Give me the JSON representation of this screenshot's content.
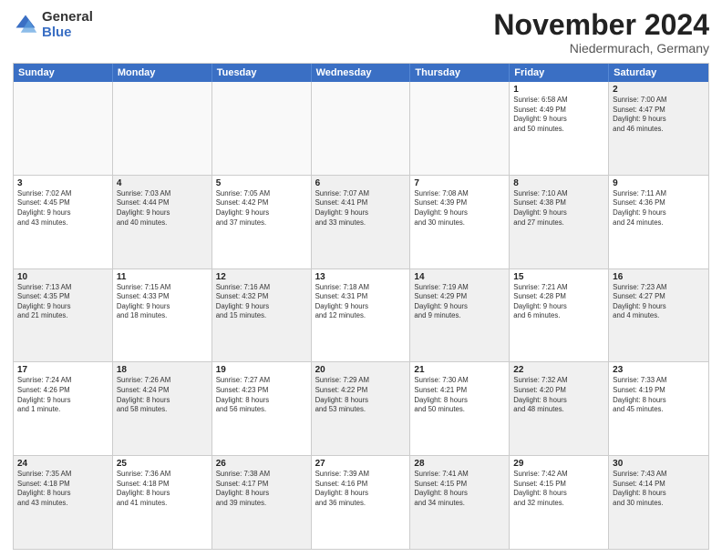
{
  "header": {
    "logo_general": "General",
    "logo_blue": "Blue",
    "month_title": "November 2024",
    "location": "Niedermurach, Germany"
  },
  "weekdays": [
    "Sunday",
    "Monday",
    "Tuesday",
    "Wednesday",
    "Thursday",
    "Friday",
    "Saturday"
  ],
  "rows": [
    [
      {
        "day": "",
        "info": "",
        "empty": true
      },
      {
        "day": "",
        "info": "",
        "empty": true
      },
      {
        "day": "",
        "info": "",
        "empty": true
      },
      {
        "day": "",
        "info": "",
        "empty": true
      },
      {
        "day": "",
        "info": "",
        "empty": true
      },
      {
        "day": "1",
        "info": "Sunrise: 6:58 AM\nSunset: 4:49 PM\nDaylight: 9 hours\nand 50 minutes."
      },
      {
        "day": "2",
        "info": "Sunrise: 7:00 AM\nSunset: 4:47 PM\nDaylight: 9 hours\nand 46 minutes.",
        "shaded": true
      }
    ],
    [
      {
        "day": "3",
        "info": "Sunrise: 7:02 AM\nSunset: 4:45 PM\nDaylight: 9 hours\nand 43 minutes."
      },
      {
        "day": "4",
        "info": "Sunrise: 7:03 AM\nSunset: 4:44 PM\nDaylight: 9 hours\nand 40 minutes.",
        "shaded": true
      },
      {
        "day": "5",
        "info": "Sunrise: 7:05 AM\nSunset: 4:42 PM\nDaylight: 9 hours\nand 37 minutes."
      },
      {
        "day": "6",
        "info": "Sunrise: 7:07 AM\nSunset: 4:41 PM\nDaylight: 9 hours\nand 33 minutes.",
        "shaded": true
      },
      {
        "day": "7",
        "info": "Sunrise: 7:08 AM\nSunset: 4:39 PM\nDaylight: 9 hours\nand 30 minutes."
      },
      {
        "day": "8",
        "info": "Sunrise: 7:10 AM\nSunset: 4:38 PM\nDaylight: 9 hours\nand 27 minutes.",
        "shaded": true
      },
      {
        "day": "9",
        "info": "Sunrise: 7:11 AM\nSunset: 4:36 PM\nDaylight: 9 hours\nand 24 minutes."
      }
    ],
    [
      {
        "day": "10",
        "info": "Sunrise: 7:13 AM\nSunset: 4:35 PM\nDaylight: 9 hours\nand 21 minutes.",
        "shaded": true
      },
      {
        "day": "11",
        "info": "Sunrise: 7:15 AM\nSunset: 4:33 PM\nDaylight: 9 hours\nand 18 minutes."
      },
      {
        "day": "12",
        "info": "Sunrise: 7:16 AM\nSunset: 4:32 PM\nDaylight: 9 hours\nand 15 minutes.",
        "shaded": true
      },
      {
        "day": "13",
        "info": "Sunrise: 7:18 AM\nSunset: 4:31 PM\nDaylight: 9 hours\nand 12 minutes."
      },
      {
        "day": "14",
        "info": "Sunrise: 7:19 AM\nSunset: 4:29 PM\nDaylight: 9 hours\nand 9 minutes.",
        "shaded": true
      },
      {
        "day": "15",
        "info": "Sunrise: 7:21 AM\nSunset: 4:28 PM\nDaylight: 9 hours\nand 6 minutes."
      },
      {
        "day": "16",
        "info": "Sunrise: 7:23 AM\nSunset: 4:27 PM\nDaylight: 9 hours\nand 4 minutes.",
        "shaded": true
      }
    ],
    [
      {
        "day": "17",
        "info": "Sunrise: 7:24 AM\nSunset: 4:26 PM\nDaylight: 9 hours\nand 1 minute."
      },
      {
        "day": "18",
        "info": "Sunrise: 7:26 AM\nSunset: 4:24 PM\nDaylight: 8 hours\nand 58 minutes.",
        "shaded": true
      },
      {
        "day": "19",
        "info": "Sunrise: 7:27 AM\nSunset: 4:23 PM\nDaylight: 8 hours\nand 56 minutes."
      },
      {
        "day": "20",
        "info": "Sunrise: 7:29 AM\nSunset: 4:22 PM\nDaylight: 8 hours\nand 53 minutes.",
        "shaded": true
      },
      {
        "day": "21",
        "info": "Sunrise: 7:30 AM\nSunset: 4:21 PM\nDaylight: 8 hours\nand 50 minutes."
      },
      {
        "day": "22",
        "info": "Sunrise: 7:32 AM\nSunset: 4:20 PM\nDaylight: 8 hours\nand 48 minutes.",
        "shaded": true
      },
      {
        "day": "23",
        "info": "Sunrise: 7:33 AM\nSunset: 4:19 PM\nDaylight: 8 hours\nand 45 minutes."
      }
    ],
    [
      {
        "day": "24",
        "info": "Sunrise: 7:35 AM\nSunset: 4:18 PM\nDaylight: 8 hours\nand 43 minutes.",
        "shaded": true
      },
      {
        "day": "25",
        "info": "Sunrise: 7:36 AM\nSunset: 4:18 PM\nDaylight: 8 hours\nand 41 minutes."
      },
      {
        "day": "26",
        "info": "Sunrise: 7:38 AM\nSunset: 4:17 PM\nDaylight: 8 hours\nand 39 minutes.",
        "shaded": true
      },
      {
        "day": "27",
        "info": "Sunrise: 7:39 AM\nSunset: 4:16 PM\nDaylight: 8 hours\nand 36 minutes."
      },
      {
        "day": "28",
        "info": "Sunrise: 7:41 AM\nSunset: 4:15 PM\nDaylight: 8 hours\nand 34 minutes.",
        "shaded": true
      },
      {
        "day": "29",
        "info": "Sunrise: 7:42 AM\nSunset: 4:15 PM\nDaylight: 8 hours\nand 32 minutes."
      },
      {
        "day": "30",
        "info": "Sunrise: 7:43 AM\nSunset: 4:14 PM\nDaylight: 8 hours\nand 30 minutes.",
        "shaded": true
      }
    ]
  ]
}
